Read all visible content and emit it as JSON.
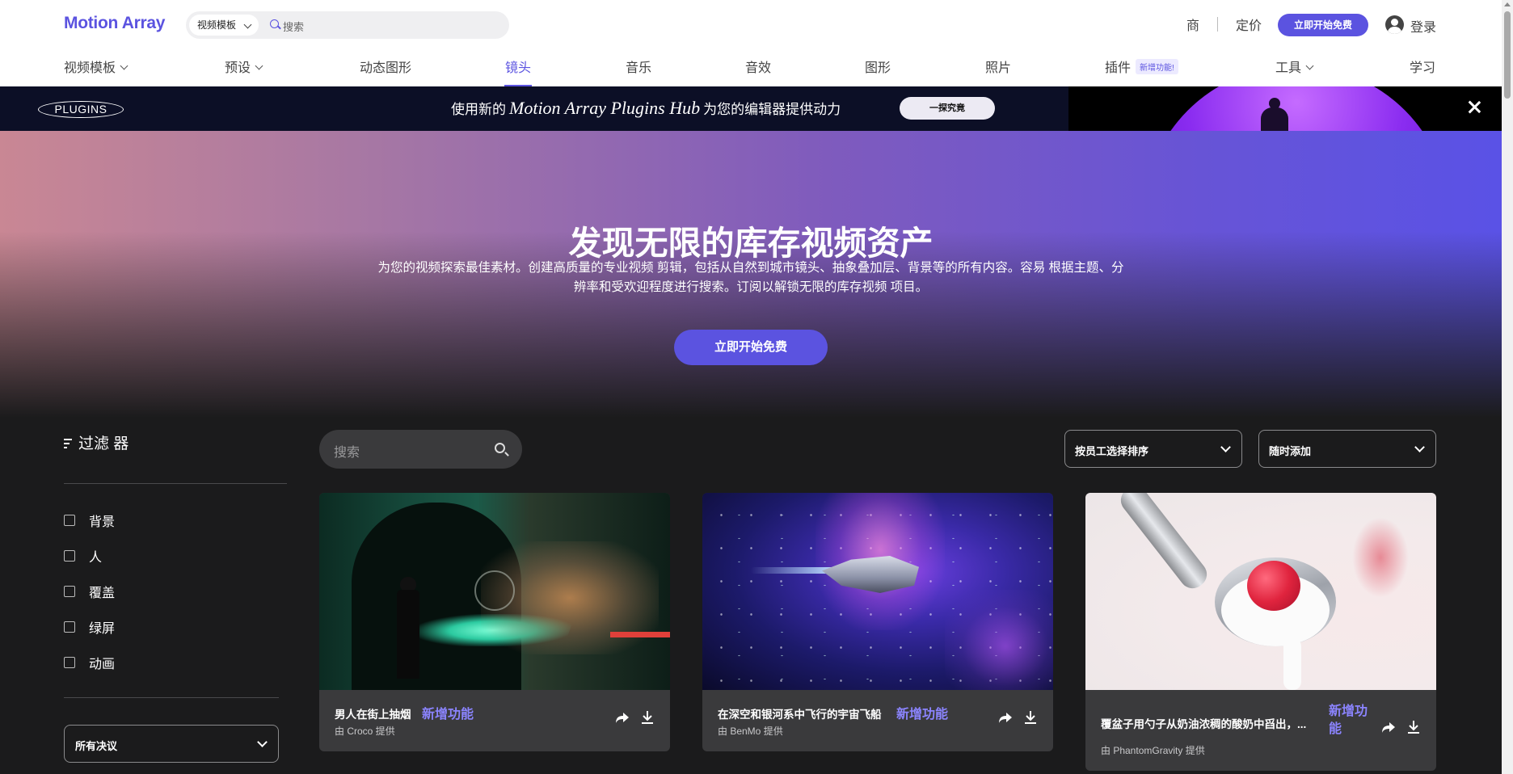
{
  "header": {
    "logo": "Motion Array",
    "search_category": "视频模板",
    "search_placeholder": "搜索",
    "link_business": "商",
    "link_pricing": "定价",
    "cta": "立即开始免费",
    "login": "登录"
  },
  "nav": {
    "items": [
      {
        "label": "视频模板",
        "dropdown": true
      },
      {
        "label": "预设",
        "dropdown": true
      },
      {
        "label": "动态图形",
        "dropdown": false
      },
      {
        "label": "镜头",
        "dropdown": false,
        "active": true
      },
      {
        "label": "音乐",
        "dropdown": false
      },
      {
        "label": "音效",
        "dropdown": false
      },
      {
        "label": "图形",
        "dropdown": false
      },
      {
        "label": "照片",
        "dropdown": false
      },
      {
        "label": "插件",
        "dropdown": false,
        "badge": "新增功能!"
      },
      {
        "label": "工具",
        "dropdown": true
      },
      {
        "label": "学习",
        "dropdown": false
      }
    ]
  },
  "banner": {
    "logo": "PLUGINS",
    "text_prefix": "使用新的",
    "text_brand": "Motion Array Plugins Hub",
    "text_suffix": "为您的编辑器提供动力",
    "button": "一探究竟"
  },
  "hero": {
    "title": "发现无限的库存视频资产",
    "subtitle": "为您的视频探索最佳素材。创建高质量的专业视频 剪辑，包括从自然到城市镜头、抽象叠加层、背景等的所有内容。容易 根据主题、分辨率和受欢迎程度进行搜索。订阅以解锁无限的库存视频 项目。",
    "cta": "立即开始免费"
  },
  "filters": {
    "title": "过滤 器",
    "categories": [
      "背景",
      "人",
      "覆盖",
      "绿屏",
      "动画"
    ],
    "resolution": "所有决议"
  },
  "toolbar": {
    "search_placeholder": "搜索",
    "sort": "按员工选择排序",
    "time": "随时添加"
  },
  "cards": [
    {
      "title": "男人在街上抽烟",
      "badge": "新增功能",
      "author": "由 Croco 提供"
    },
    {
      "title": "在深空和银河系中飞行的宇宙飞船",
      "badge": "新增功能",
      "author": "由 BenMo 提供"
    },
    {
      "title": "覆盆子用勺子从奶油浓稠的酸奶中舀出，...",
      "badge": "新增功能",
      "author": "由 PhantomGravity 提供"
    }
  ],
  "colors": {
    "accent": "#5b53e0",
    "badge_text": "#8b84ff",
    "page_bg": "#1b1b1c"
  }
}
